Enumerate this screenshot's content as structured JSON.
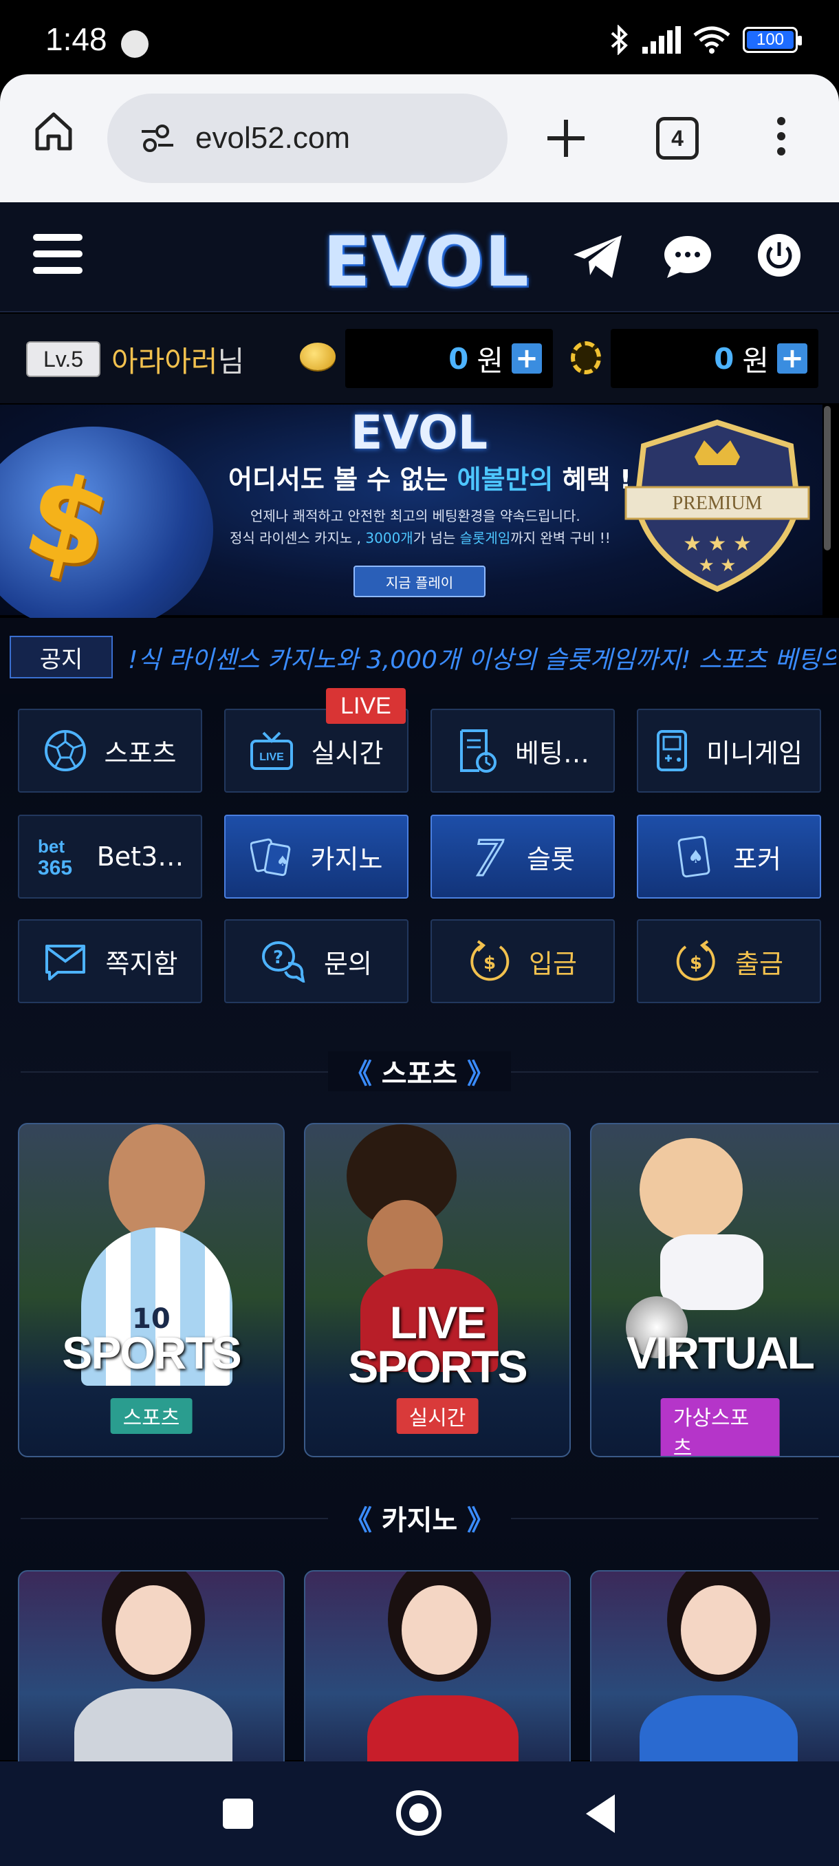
{
  "status_bar": {
    "time": "1:48",
    "battery": "100"
  },
  "browser": {
    "url": "evol52.com",
    "tab_count": "4"
  },
  "site": {
    "logo": "EVOL"
  },
  "user": {
    "level": "Lv.5",
    "name": "아라아러",
    "suffix": "님",
    "balance1": "0",
    "balance2": "0",
    "currency": "원"
  },
  "banner": {
    "logo": "EVOL",
    "title_a": "어디서도 볼 수 없는 ",
    "title_hl": "에볼만의",
    "title_b": " 혜택 !",
    "sub1": "언제나 쾌적하고 안전한 최고의 베팅환경을 약속드립니다.",
    "sub2_a": "정식 라이센스 카지노 , ",
    "sub2_hl1": "3000개",
    "sub2_b": "가 넘는 ",
    "sub2_hl2": "슬롯게임",
    "sub2_c": "까지 완벽 구비 !!",
    "button": "지금 플레이",
    "badge": "PREMIUM"
  },
  "notice": {
    "label": "공지",
    "text": "!식 라이센스 카지노와 3,000개 이상의 슬롯게임까지! 스포츠 베팅의 ,"
  },
  "menu": {
    "live_tag": "LIVE",
    "items": [
      {
        "label": "스포츠",
        "icon": "soccer-ball-icon"
      },
      {
        "label": "실시간",
        "icon": "live-tv-icon"
      },
      {
        "label": "베팅…",
        "icon": "betting-slip-icon"
      },
      {
        "label": "미니게임",
        "icon": "gameboy-icon"
      },
      {
        "label": "Bet3…",
        "icon": "bet365-logo-icon",
        "logo_top": "bet",
        "logo_bottom": "365"
      },
      {
        "label": "카지노",
        "icon": "playing-cards-icon"
      },
      {
        "label": "슬롯",
        "icon": "lucky-seven-icon",
        "glyph": "7"
      },
      {
        "label": "포커",
        "icon": "poker-card-icon"
      },
      {
        "label": "쪽지함",
        "icon": "envelope-icon"
      },
      {
        "label": "문의",
        "icon": "question-chat-icon"
      },
      {
        "label": "입금",
        "icon": "deposit-coin-icon"
      },
      {
        "label": "출금",
        "icon": "withdraw-coin-icon"
      }
    ]
  },
  "sections": {
    "sports": "스포츠",
    "casino": "카지노",
    "arrow_left": "《",
    "arrow_right": "》"
  },
  "sport_cards": [
    {
      "title": "SPORTS",
      "pill": "스포츠",
      "pill_color": "#2a9d8f",
      "jersey": "10"
    },
    {
      "title_1": "LIVE",
      "title_2": "SPORTS",
      "pill": "실시간",
      "pill_color": "#d93a3a"
    },
    {
      "title": "VIRTUAL",
      "pill": "가상스포츠",
      "pill_color": "#b535c9"
    }
  ]
}
